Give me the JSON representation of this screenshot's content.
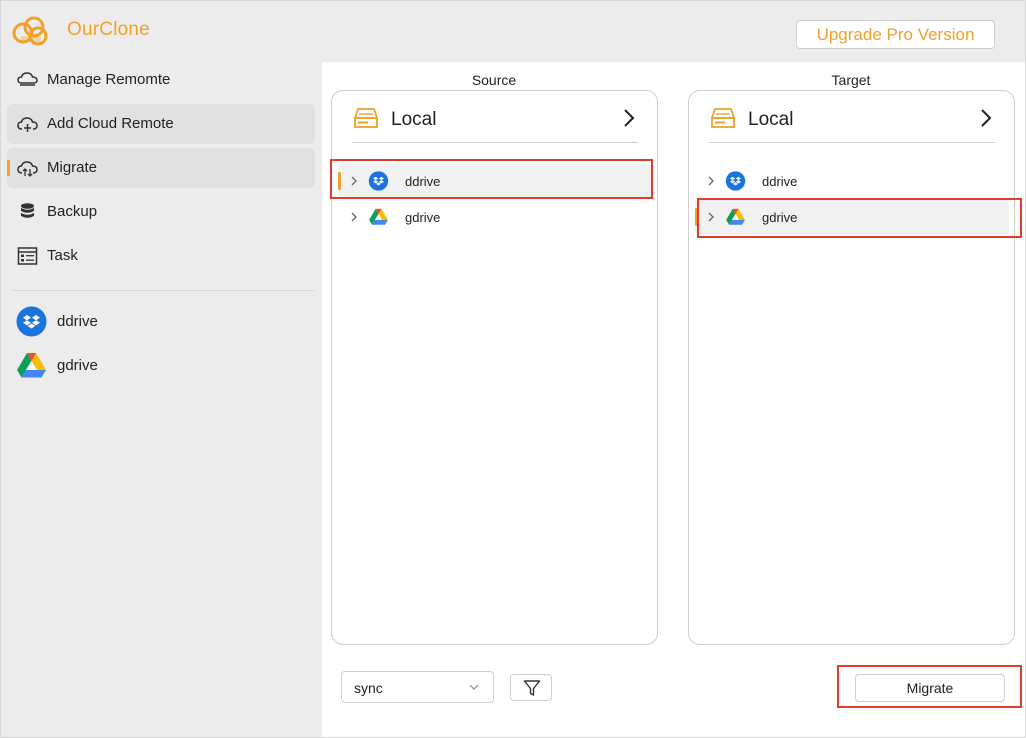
{
  "app": {
    "title": "OurClone",
    "upgrade_label": "Upgrade Pro Version",
    "accent_color": "#f0a12a",
    "highlight_color": "#e53b2c"
  },
  "sidebar": {
    "items": [
      {
        "label": "Manage Remomte",
        "icon": "cloud-stack-icon",
        "active": false
      },
      {
        "label": "Add Cloud Remote",
        "icon": "cloud-add-icon",
        "active": true
      },
      {
        "label": "Migrate",
        "icon": "cloud-sync-icon",
        "active": true
      },
      {
        "label": "Backup",
        "icon": "database-icon",
        "active": false
      },
      {
        "label": "Task",
        "icon": "task-list-icon",
        "active": false
      }
    ],
    "remotes": [
      {
        "label": "ddrive",
        "icon": "dropbox-icon"
      },
      {
        "label": "gdrive",
        "icon": "google-drive-icon"
      }
    ]
  },
  "source": {
    "title": "Source",
    "drive_label": "Local",
    "drive_icon": "hard-drive-icon",
    "rows": [
      {
        "label": "ddrive",
        "icon": "dropbox-icon",
        "selected": true
      },
      {
        "label": "gdrive",
        "icon": "google-drive-icon",
        "selected": false
      }
    ]
  },
  "target": {
    "title": "Target",
    "drive_label": "Local",
    "drive_icon": "hard-drive-icon",
    "rows": [
      {
        "label": "ddrive",
        "icon": "dropbox-icon",
        "selected": false
      },
      {
        "label": "gdrive",
        "icon": "google-drive-icon",
        "selected": true
      }
    ]
  },
  "controls": {
    "mode_value": "sync",
    "filter_icon": "filter-icon",
    "migrate_label": "Migrate"
  }
}
